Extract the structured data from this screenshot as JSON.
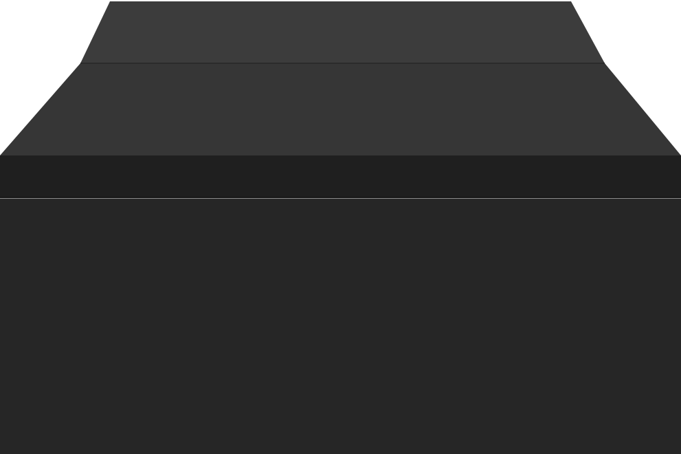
{
  "product": {
    "kind": "monitor riser shelf",
    "view": "front elevation",
    "colors": {
      "background": "#ffffff",
      "top_back_panel": "#3c3c3c",
      "top_front_panel": "#363636",
      "front_face": "#262626",
      "top_edge_band": "#1f1f1f",
      "seam": "#1a1a1a"
    }
  }
}
